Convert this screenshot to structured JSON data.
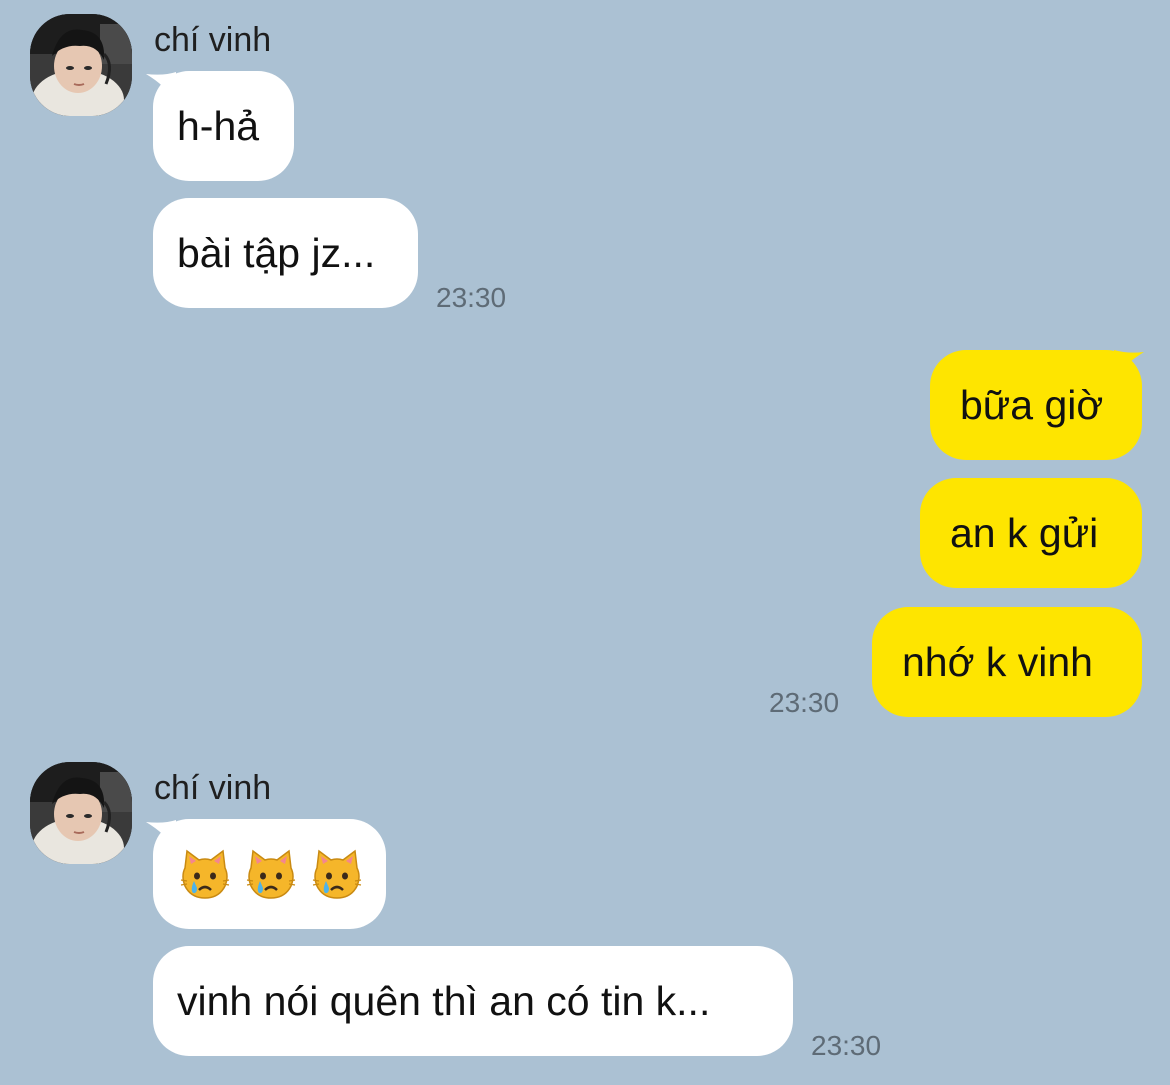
{
  "colors": {
    "background": "#abc1d3",
    "incoming_bubble": "#ffffff",
    "outgoing_bubble": "#fee500",
    "timestamp": "#5e6b76"
  },
  "group1": {
    "sender": "chí vinh",
    "messages": [
      "h-hả",
      "bài tập jz..."
    ],
    "time": "23:30"
  },
  "group2": {
    "messages": [
      "bữa giờ",
      "an k gửi",
      "nhớ k vinh"
    ],
    "time": "23:30"
  },
  "group3": {
    "sender": "chí vinh",
    "emoji_icons": [
      "crying-cat-emoji",
      "crying-cat-emoji",
      "crying-cat-emoji"
    ],
    "messages": [
      "vinh nói quên thì an có tin k..."
    ],
    "time": "23:30"
  }
}
